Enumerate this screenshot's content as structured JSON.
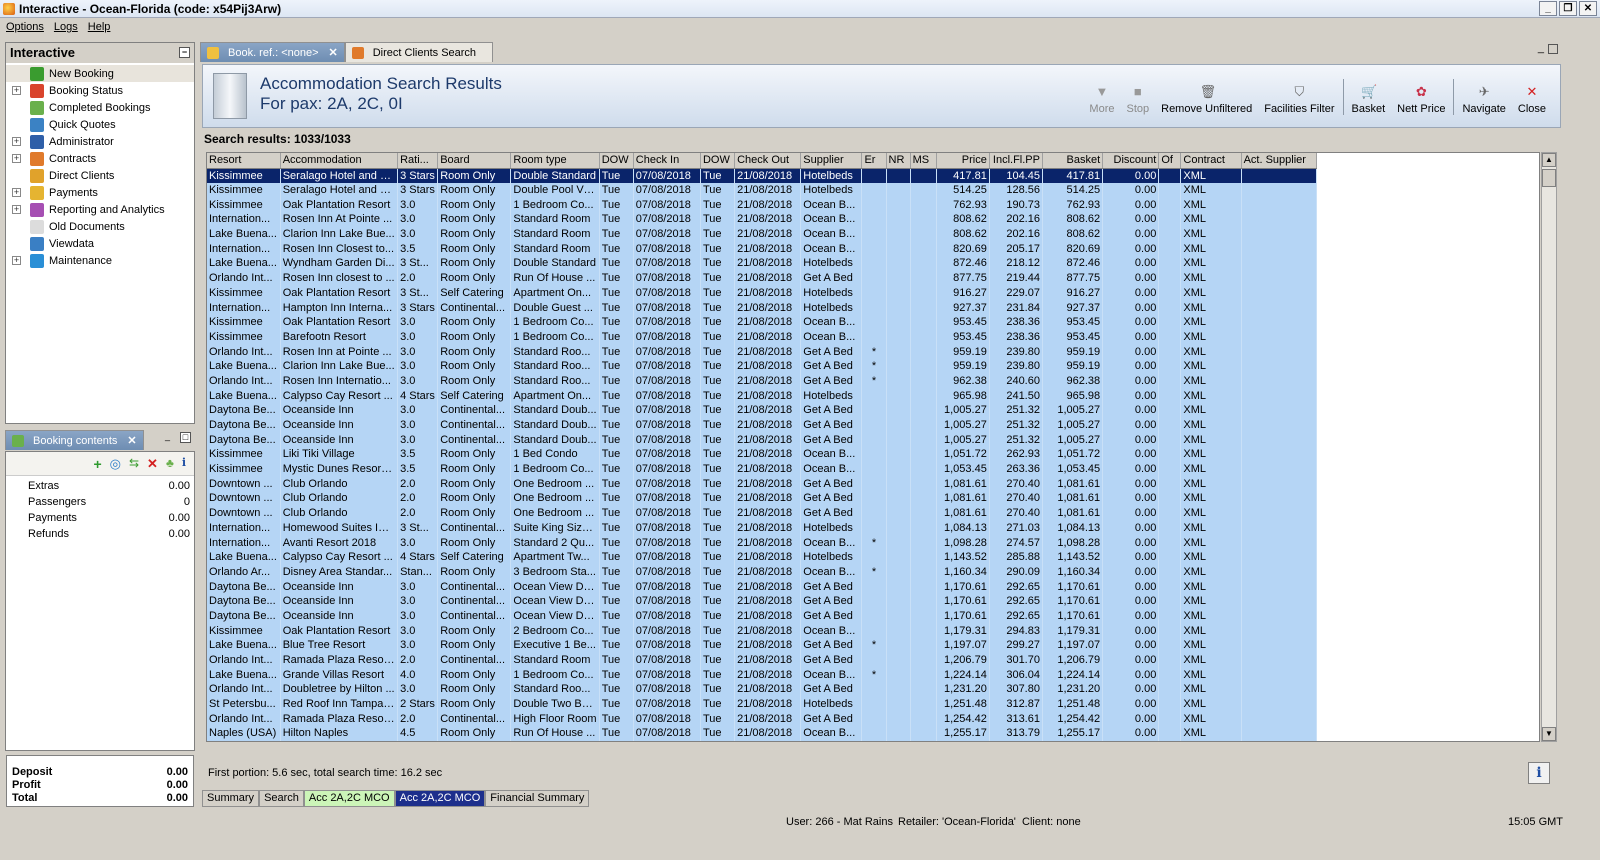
{
  "window": {
    "title": "Interactive - Ocean-Florida (code: x54Pij3Arw)"
  },
  "menu": [
    "Options",
    "Logs",
    "Help"
  ],
  "nav": {
    "title": "Interactive",
    "items": [
      {
        "label": "New Booking",
        "expand": false,
        "color": "#3a9c2f"
      },
      {
        "label": "Booking Status",
        "expand": true,
        "color": "#d9442c"
      },
      {
        "label": "Completed Bookings",
        "expand": false,
        "color": "#6ab04c"
      },
      {
        "label": "Quick Quotes",
        "expand": false,
        "color": "#3b82c4"
      },
      {
        "label": "Administrator",
        "expand": true,
        "color": "#2f5fa8"
      },
      {
        "label": "Contracts",
        "expand": true,
        "color": "#e07a2b"
      },
      {
        "label": "Direct Clients",
        "expand": false,
        "color": "#e0a22b"
      },
      {
        "label": "Payments",
        "expand": true,
        "color": "#e5b431"
      },
      {
        "label": "Reporting and Analytics",
        "expand": true,
        "color": "#a64fb3"
      },
      {
        "label": "Old Documents",
        "expand": false,
        "color": "#dcdcdc"
      },
      {
        "label": "Viewdata",
        "expand": false,
        "color": "#3a7fc4"
      },
      {
        "label": "Maintenance",
        "expand": true,
        "color": "#2a8fd6"
      }
    ]
  },
  "booking_contents": {
    "tab_label": "Booking contents",
    "rows": [
      {
        "label": "Extras",
        "value": "0.00"
      },
      {
        "label": "Passengers",
        "value": "0"
      },
      {
        "label": "Payments",
        "value": "0.00"
      },
      {
        "label": "Refunds",
        "value": "0.00"
      }
    ],
    "totals": [
      {
        "label": "Deposit",
        "value": "0.00"
      },
      {
        "label": "Profit",
        "value": "0.00"
      },
      {
        "label": "Total",
        "value": "0.00"
      }
    ]
  },
  "tabs": [
    {
      "label": "Book. ref.: <none>",
      "active": true
    },
    {
      "label": "Direct Clients Search",
      "active": false
    }
  ],
  "header": {
    "title": "Accommodation Search Results",
    "subtitle": "For pax: 2A, 2C, 0I"
  },
  "toolbar": [
    {
      "label": "More",
      "icon": "▼",
      "disabled": true
    },
    {
      "label": "Stop",
      "icon": "■",
      "disabled": true
    },
    {
      "label": "Remove Unfiltered",
      "icon": "🗑",
      "disabled": false
    },
    {
      "label": "Facilities Filter",
      "icon": "⛉",
      "disabled": false
    },
    {
      "sep": true
    },
    {
      "label": "Basket",
      "icon": "🛒",
      "disabled": false
    },
    {
      "label": "Nett Price",
      "icon": "✿",
      "disabled": false
    },
    {
      "sep": true
    },
    {
      "label": "Navigate",
      "icon": "✈",
      "disabled": false
    },
    {
      "label": "Close",
      "icon": "✕",
      "disabled": false
    }
  ],
  "results": {
    "label": "Search results: 1033/1033",
    "columns": [
      "Resort",
      "Accommodation",
      "Rati...",
      "Board",
      "Room type",
      "DOW",
      "Check In",
      "DOW",
      "Check Out",
      "Supplier",
      "Er",
      "NR",
      "MS",
      "Price",
      "Incl.Fl.PP",
      "Basket",
      "Discount",
      "Of",
      "Contract",
      "Act. Supplier"
    ],
    "rows": [
      [
        "Kissimmee",
        "Seralago Hotel and S...",
        "3 Stars",
        "Room Only",
        "Double Standard",
        "Tue",
        "07/08/2018",
        "Tue",
        "21/08/2018",
        "Hotelbeds",
        "",
        "",
        "",
        "417.81",
        "104.45",
        "417.81",
        "0.00",
        "",
        "XML",
        ""
      ],
      [
        "Kissimmee",
        "Seralago Hotel and S...",
        "3 Stars",
        "Room Only",
        "Double Pool View",
        "Tue",
        "07/08/2018",
        "Tue",
        "21/08/2018",
        "Hotelbeds",
        "",
        "",
        "",
        "514.25",
        "128.56",
        "514.25",
        "0.00",
        "",
        "XML",
        ""
      ],
      [
        "Kissimmee",
        "Oak Plantation Resort",
        "3.0",
        "Room Only",
        "1 Bedroom Co...",
        "Tue",
        "07/08/2018",
        "Tue",
        "21/08/2018",
        "Ocean B...",
        "",
        "",
        "",
        "762.93",
        "190.73",
        "762.93",
        "0.00",
        "",
        "XML",
        ""
      ],
      [
        "Internation...",
        "Rosen Inn At Pointe ...",
        "3.0",
        "Room Only",
        "Standard Room",
        "Tue",
        "07/08/2018",
        "Tue",
        "21/08/2018",
        "Ocean B...",
        "",
        "",
        "",
        "808.62",
        "202.16",
        "808.62",
        "0.00",
        "",
        "XML",
        ""
      ],
      [
        "Lake Buena...",
        "Clarion Inn Lake Bue...",
        "3.0",
        "Room Only",
        "Standard Room",
        "Tue",
        "07/08/2018",
        "Tue",
        "21/08/2018",
        "Ocean B...",
        "",
        "",
        "",
        "808.62",
        "202.16",
        "808.62",
        "0.00",
        "",
        "XML",
        ""
      ],
      [
        "Internation...",
        "Rosen Inn Closest to...",
        "3.5",
        "Room Only",
        "Standard Room",
        "Tue",
        "07/08/2018",
        "Tue",
        "21/08/2018",
        "Ocean B...",
        "",
        "",
        "",
        "820.69",
        "205.17",
        "820.69",
        "0.00",
        "",
        "XML",
        ""
      ],
      [
        "Lake Buena...",
        "Wyndham Garden Di...",
        "3 St...",
        "Room Only",
        "Double Standard",
        "Tue",
        "07/08/2018",
        "Tue",
        "21/08/2018",
        "Hotelbeds",
        "",
        "",
        "",
        "872.46",
        "218.12",
        "872.46",
        "0.00",
        "",
        "XML",
        ""
      ],
      [
        "Orlando Int...",
        "Rosen Inn closest to ...",
        "2.0",
        "Room Only",
        "Run Of House ...",
        "Tue",
        "07/08/2018",
        "Tue",
        "21/08/2018",
        "Get A Bed",
        "",
        "",
        "",
        "877.75",
        "219.44",
        "877.75",
        "0.00",
        "",
        "XML",
        ""
      ],
      [
        "Kissimmee",
        "Oak Plantation Resort",
        "3 St...",
        "Self Catering",
        "Apartment On...",
        "Tue",
        "07/08/2018",
        "Tue",
        "21/08/2018",
        "Hotelbeds",
        "",
        "",
        "",
        "916.27",
        "229.07",
        "916.27",
        "0.00",
        "",
        "XML",
        ""
      ],
      [
        "Internation...",
        "Hampton Inn Interna...",
        "3 Stars",
        "Continental...",
        "Double Guest ...",
        "Tue",
        "07/08/2018",
        "Tue",
        "21/08/2018",
        "Hotelbeds",
        "",
        "",
        "",
        "927.37",
        "231.84",
        "927.37",
        "0.00",
        "",
        "XML",
        ""
      ],
      [
        "Kissimmee",
        "Oak Plantation Resort",
        "3.0",
        "Room Only",
        "1 Bedroom Co...",
        "Tue",
        "07/08/2018",
        "Tue",
        "21/08/2018",
        "Ocean B...",
        "",
        "",
        "",
        "953.45",
        "238.36",
        "953.45",
        "0.00",
        "",
        "XML",
        ""
      ],
      [
        "Kissimmee",
        "Barefootn Resort",
        "3.0",
        "Room Only",
        "1 Bedroom Co...",
        "Tue",
        "07/08/2018",
        "Tue",
        "21/08/2018",
        "Ocean B...",
        "",
        "",
        "",
        "953.45",
        "238.36",
        "953.45",
        "0.00",
        "",
        "XML",
        ""
      ],
      [
        "Orlando Int...",
        "Rosen Inn at Pointe ...",
        "3.0",
        "Room Only",
        "Standard Roo...",
        "Tue",
        "07/08/2018",
        "Tue",
        "21/08/2018",
        "Get A Bed",
        "*",
        "",
        "",
        "959.19",
        "239.80",
        "959.19",
        "0.00",
        "",
        "XML",
        ""
      ],
      [
        "Lake Buena...",
        "Clarion Inn Lake Bue...",
        "3.0",
        "Room Only",
        "Standard Roo...",
        "Tue",
        "07/08/2018",
        "Tue",
        "21/08/2018",
        "Get A Bed",
        "*",
        "",
        "",
        "959.19",
        "239.80",
        "959.19",
        "0.00",
        "",
        "XML",
        ""
      ],
      [
        "Orlando Int...",
        "Rosen Inn Internatio...",
        "3.0",
        "Room Only",
        "Standard Roo...",
        "Tue",
        "07/08/2018",
        "Tue",
        "21/08/2018",
        "Get A Bed",
        "*",
        "",
        "",
        "962.38",
        "240.60",
        "962.38",
        "0.00",
        "",
        "XML",
        ""
      ],
      [
        "Lake Buena...",
        "Calypso Cay Resort ...",
        "4 Stars",
        "Self Catering",
        "Apartment On...",
        "Tue",
        "07/08/2018",
        "Tue",
        "21/08/2018",
        "Hotelbeds",
        "",
        "",
        "",
        "965.98",
        "241.50",
        "965.98",
        "0.00",
        "",
        "XML",
        ""
      ],
      [
        "Daytona Be...",
        "Oceanside Inn",
        "3.0",
        "Continental...",
        "Standard Doub...",
        "Tue",
        "07/08/2018",
        "Tue",
        "21/08/2018",
        "Get A Bed",
        "",
        "",
        "",
        "1,005.27",
        "251.32",
        "1,005.27",
        "0.00",
        "",
        "XML",
        ""
      ],
      [
        "Daytona Be...",
        "Oceanside Inn",
        "3.0",
        "Continental...",
        "Standard Doub...",
        "Tue",
        "07/08/2018",
        "Tue",
        "21/08/2018",
        "Get A Bed",
        "",
        "",
        "",
        "1,005.27",
        "251.32",
        "1,005.27",
        "0.00",
        "",
        "XML",
        ""
      ],
      [
        "Daytona Be...",
        "Oceanside Inn",
        "3.0",
        "Continental...",
        "Standard Doub...",
        "Tue",
        "07/08/2018",
        "Tue",
        "21/08/2018",
        "Get A Bed",
        "",
        "",
        "",
        "1,005.27",
        "251.32",
        "1,005.27",
        "0.00",
        "",
        "XML",
        ""
      ],
      [
        "Kissimmee",
        "Liki Tiki Village",
        "3.5",
        "Room Only",
        "1 Bed Condo",
        "Tue",
        "07/08/2018",
        "Tue",
        "21/08/2018",
        "Ocean B...",
        "",
        "",
        "",
        "1,051.72",
        "262.93",
        "1,051.72",
        "0.00",
        "",
        "XML",
        ""
      ],
      [
        "Kissimmee",
        "Mystic Dunes Resort ...",
        "3.5",
        "Room Only",
        "1 Bedroom Co...",
        "Tue",
        "07/08/2018",
        "Tue",
        "21/08/2018",
        "Ocean B...",
        "",
        "",
        "",
        "1,053.45",
        "263.36",
        "1,053.45",
        "0.00",
        "",
        "XML",
        ""
      ],
      [
        "Downtown ...",
        "Club Orlando",
        "2.0",
        "Room Only",
        "One Bedroom ...",
        "Tue",
        "07/08/2018",
        "Tue",
        "21/08/2018",
        "Get A Bed",
        "",
        "",
        "",
        "1,081.61",
        "270.40",
        "1,081.61",
        "0.00",
        "",
        "XML",
        ""
      ],
      [
        "Downtown ...",
        "Club Orlando",
        "2.0",
        "Room Only",
        "One Bedroom ...",
        "Tue",
        "07/08/2018",
        "Tue",
        "21/08/2018",
        "Get A Bed",
        "",
        "",
        "",
        "1,081.61",
        "270.40",
        "1,081.61",
        "0.00",
        "",
        "XML",
        ""
      ],
      [
        "Downtown ...",
        "Club Orlando",
        "2.0",
        "Room Only",
        "One Bedroom ...",
        "Tue",
        "07/08/2018",
        "Tue",
        "21/08/2018",
        "Get A Bed",
        "",
        "",
        "",
        "1,081.61",
        "270.40",
        "1,081.61",
        "0.00",
        "",
        "XML",
        ""
      ],
      [
        "Internation...",
        "Homewood Suites Int...",
        "3 St...",
        "Continental...",
        "Suite King Size ...",
        "Tue",
        "07/08/2018",
        "Tue",
        "21/08/2018",
        "Hotelbeds",
        "",
        "",
        "",
        "1,084.13",
        "271.03",
        "1,084.13",
        "0.00",
        "",
        "XML",
        ""
      ],
      [
        "Internation...",
        "Avanti Resort 2018",
        "3.0",
        "Room Only",
        "Standard 2 Qu...",
        "Tue",
        "07/08/2018",
        "Tue",
        "21/08/2018",
        "Ocean B...",
        "*",
        "",
        "",
        "1,098.28",
        "274.57",
        "1,098.28",
        "0.00",
        "",
        "XML",
        ""
      ],
      [
        "Lake Buena...",
        "Calypso Cay Resort ...",
        "4 Stars",
        "Self Catering",
        "Apartment Tw...",
        "Tue",
        "07/08/2018",
        "Tue",
        "21/08/2018",
        "Hotelbeds",
        "",
        "",
        "",
        "1,143.52",
        "285.88",
        "1,143.52",
        "0.00",
        "",
        "XML",
        ""
      ],
      [
        "Orlando Ar...",
        "Disney Area Standar...",
        "Stan...",
        "Room Only",
        "3 Bedroom Sta...",
        "Tue",
        "07/08/2018",
        "Tue",
        "21/08/2018",
        "Ocean B...",
        "*",
        "",
        "",
        "1,160.34",
        "290.09",
        "1,160.34",
        "0.00",
        "",
        "XML",
        ""
      ],
      [
        "Daytona Be...",
        "Oceanside Inn",
        "3.0",
        "Continental...",
        "Ocean View Do...",
        "Tue",
        "07/08/2018",
        "Tue",
        "21/08/2018",
        "Get A Bed",
        "",
        "",
        "",
        "1,170.61",
        "292.65",
        "1,170.61",
        "0.00",
        "",
        "XML",
        ""
      ],
      [
        "Daytona Be...",
        "Oceanside Inn",
        "3.0",
        "Continental...",
        "Ocean View Do...",
        "Tue",
        "07/08/2018",
        "Tue",
        "21/08/2018",
        "Get A Bed",
        "",
        "",
        "",
        "1,170.61",
        "292.65",
        "1,170.61",
        "0.00",
        "",
        "XML",
        ""
      ],
      [
        "Daytona Be...",
        "Oceanside Inn",
        "3.0",
        "Continental...",
        "Ocean View Do...",
        "Tue",
        "07/08/2018",
        "Tue",
        "21/08/2018",
        "Get A Bed",
        "",
        "",
        "",
        "1,170.61",
        "292.65",
        "1,170.61",
        "0.00",
        "",
        "XML",
        ""
      ],
      [
        "Kissimmee",
        "Oak Plantation Resort",
        "3.0",
        "Room Only",
        "2 Bedroom Co...",
        "Tue",
        "07/08/2018",
        "Tue",
        "21/08/2018",
        "Ocean B...",
        "",
        "",
        "",
        "1,179.31",
        "294.83",
        "1,179.31",
        "0.00",
        "",
        "XML",
        ""
      ],
      [
        "Lake Buena...",
        "Blue Tree Resort",
        "3.0",
        "Room Only",
        "Executive 1 Be...",
        "Tue",
        "07/08/2018",
        "Tue",
        "21/08/2018",
        "Get A Bed",
        "*",
        "",
        "",
        "1,197.07",
        "299.27",
        "1,197.07",
        "0.00",
        "",
        "XML",
        ""
      ],
      [
        "Orlando Int...",
        "Ramada Plaza Resort...",
        "2.0",
        "Continental...",
        "Standard Room",
        "Tue",
        "07/08/2018",
        "Tue",
        "21/08/2018",
        "Get A Bed",
        "",
        "",
        "",
        "1,206.79",
        "301.70",
        "1,206.79",
        "0.00",
        "",
        "XML",
        ""
      ],
      [
        "Lake Buena...",
        "Grande Villas Resort",
        "4.0",
        "Room Only",
        "1 Bedroom Co...",
        "Tue",
        "07/08/2018",
        "Tue",
        "21/08/2018",
        "Ocean B...",
        "*",
        "",
        "",
        "1,224.14",
        "306.04",
        "1,224.14",
        "0.00",
        "",
        "XML",
        ""
      ],
      [
        "Orlando Int...",
        "Doubletree by Hilton ...",
        "3.0",
        "Room Only",
        "Standard Roo...",
        "Tue",
        "07/08/2018",
        "Tue",
        "21/08/2018",
        "Get A Bed",
        "",
        "",
        "",
        "1,231.20",
        "307.80",
        "1,231.20",
        "0.00",
        "",
        "XML",
        ""
      ],
      [
        "St Petersbu...",
        "Red Roof Inn Tampa ...",
        "2 Stars",
        "Room Only",
        "Double Two Beds",
        "Tue",
        "07/08/2018",
        "Tue",
        "21/08/2018",
        "Hotelbeds",
        "",
        "",
        "",
        "1,251.48",
        "312.87",
        "1,251.48",
        "0.00",
        "",
        "XML",
        ""
      ],
      [
        "Orlando Int...",
        "Ramada Plaza Resort...",
        "2.0",
        "Continental...",
        "High Floor Room",
        "Tue",
        "07/08/2018",
        "Tue",
        "21/08/2018",
        "Get A Bed",
        "",
        "",
        "",
        "1,254.42",
        "313.61",
        "1,254.42",
        "0.00",
        "",
        "XML",
        ""
      ],
      [
        "Naples (USA)",
        "Hilton Naples",
        "4.5",
        "Room Only",
        "Run Of House ...",
        "Tue",
        "07/08/2018",
        "Tue",
        "21/08/2018",
        "Ocean B...",
        "",
        "",
        "",
        "1,255.17",
        "313.79",
        "1,255.17",
        "0.00",
        "",
        "XML",
        ""
      ]
    ]
  },
  "footer_info": "First portion: 5.6 sec, total search time: 16.2 sec",
  "bottom_tabs": [
    {
      "label": "Summary",
      "style": "plain"
    },
    {
      "label": "Search",
      "style": "plain"
    },
    {
      "label": "Acc 2A,2C MCO",
      "style": "green"
    },
    {
      "label": "Acc 2A,2C MCO",
      "style": "active"
    },
    {
      "label": "Financial Summary",
      "style": "plain"
    }
  ],
  "status": {
    "user": "User: 266 - Mat Rains",
    "retailer": "Retailer: 'Ocean-Florida'",
    "client": "Client: none",
    "time": "15:05 GMT"
  }
}
